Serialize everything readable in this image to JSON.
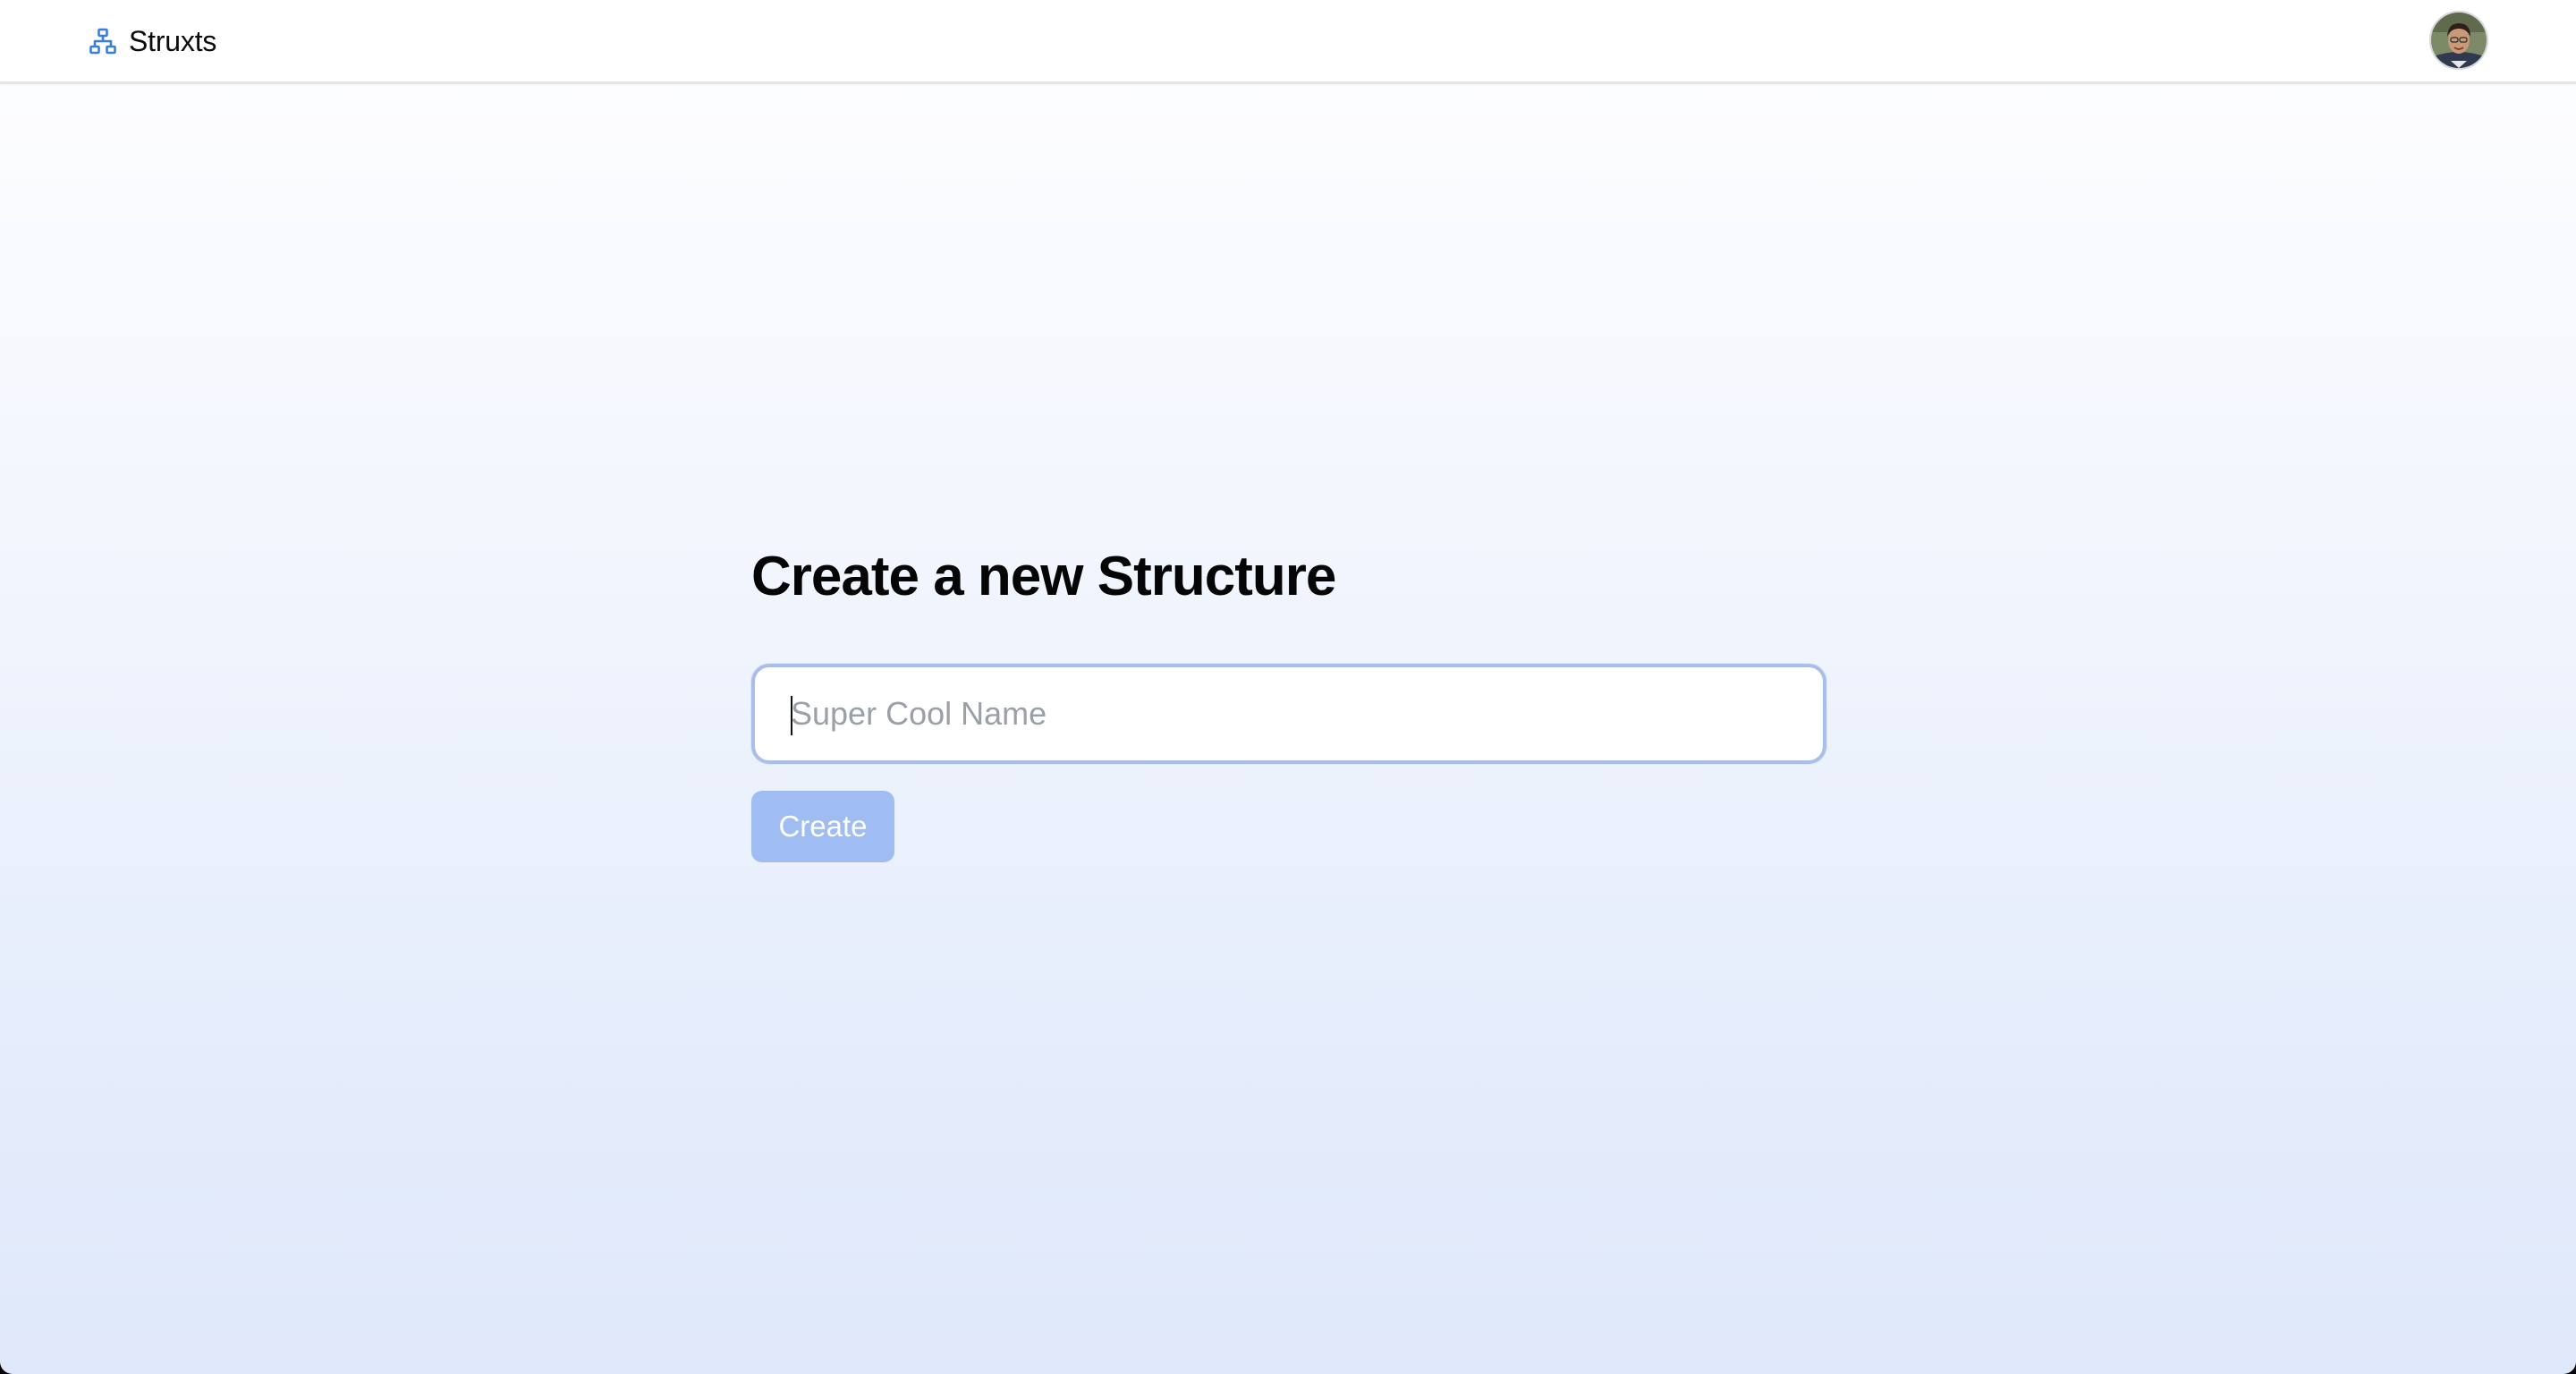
{
  "header": {
    "app_name": "Struxts",
    "logo_icon": "sitemap-icon",
    "accent_color": "#3b82f6",
    "avatar_icon": "user-avatar"
  },
  "main": {
    "title": "Create a new Structure",
    "name_input": {
      "value": "",
      "placeholder": "Super Cool Name"
    },
    "create_button": {
      "label": "Create",
      "disabled": true,
      "color": "#9fbdf3"
    }
  }
}
